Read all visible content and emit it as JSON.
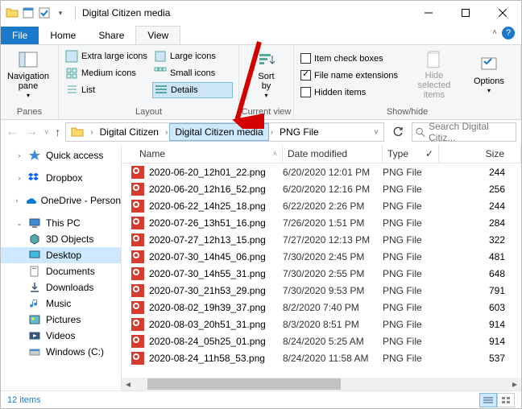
{
  "window": {
    "title": "Digital Citizen media"
  },
  "tabs": {
    "file": "File",
    "home": "Home",
    "share": "Share",
    "view": "View"
  },
  "ribbon": {
    "panes": {
      "button": "Navigation\npane",
      "label": "Panes"
    },
    "layout": {
      "xl": "Extra large icons",
      "lg": "Large icons",
      "sm": "Small icons",
      "md": "Medium icons",
      "list": "List",
      "details": "Details",
      "label": "Layout"
    },
    "current": {
      "sort": "Sort\nby",
      "label": "Current view"
    },
    "showhide": {
      "itemcb": "Item check boxes",
      "ext": "File name extensions",
      "hidden": "Hidden items",
      "hidebtn": "Hide selected\nitems",
      "options": "Options",
      "label": "Show/hide"
    }
  },
  "breadcrumbs": {
    "b1": "Digital Citizen",
    "b2": "Digital Citizen media",
    "b3": "PNG File"
  },
  "search": {
    "placeholder": "Search Digital Citiz..."
  },
  "nav": {
    "quick": "Quick access",
    "dropbox": "Dropbox",
    "onedrive": "OneDrive - Person",
    "thispc": "This PC",
    "d3": "3D Objects",
    "desktop": "Desktop",
    "documents": "Documents",
    "downloads": "Downloads",
    "music": "Music",
    "pictures": "Pictures",
    "videos": "Videos",
    "cdrive": "Windows (C:)"
  },
  "columns": {
    "name": "Name",
    "date": "Date modified",
    "type": "Type",
    "size": "Size"
  },
  "files": [
    {
      "name": "2020-06-20_12h01_22.png",
      "date": "6/20/2020 12:01 PM",
      "type": "PNG File",
      "size": "244"
    },
    {
      "name": "2020-06-20_12h16_52.png",
      "date": "6/20/2020 12:16 PM",
      "type": "PNG File",
      "size": "256"
    },
    {
      "name": "2020-06-22_14h25_18.png",
      "date": "6/22/2020 2:26 PM",
      "type": "PNG File",
      "size": "244"
    },
    {
      "name": "2020-07-26_13h51_16.png",
      "date": "7/26/2020 1:51 PM",
      "type": "PNG File",
      "size": "284"
    },
    {
      "name": "2020-07-27_12h13_15.png",
      "date": "7/27/2020 12:13 PM",
      "type": "PNG File",
      "size": "322"
    },
    {
      "name": "2020-07-30_14h45_06.png",
      "date": "7/30/2020 2:45 PM",
      "type": "PNG File",
      "size": "481"
    },
    {
      "name": "2020-07-30_14h55_31.png",
      "date": "7/30/2020 2:55 PM",
      "type": "PNG File",
      "size": "648"
    },
    {
      "name": "2020-07-30_21h53_29.png",
      "date": "7/30/2020 9:53 PM",
      "type": "PNG File",
      "size": "791"
    },
    {
      "name": "2020-08-02_19h39_37.png",
      "date": "8/2/2020 7:40 PM",
      "type": "PNG File",
      "size": "603"
    },
    {
      "name": "2020-08-03_20h51_31.png",
      "date": "8/3/2020 8:51 PM",
      "type": "PNG File",
      "size": "914"
    },
    {
      "name": "2020-08-24_05h25_01.png",
      "date": "8/24/2020 5:25 AM",
      "type": "PNG File",
      "size": "914"
    },
    {
      "name": "2020-08-24_11h58_53.png",
      "date": "8/24/2020 11:58 AM",
      "type": "PNG File",
      "size": "537"
    }
  ],
  "status": {
    "count": "12 items"
  }
}
